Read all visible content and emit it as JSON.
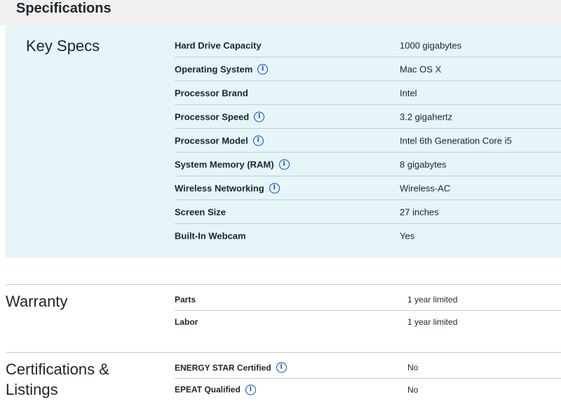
{
  "header": {
    "title": "Specifications"
  },
  "key_specs": {
    "title": "Key Specs",
    "rows": [
      {
        "label": "Hard Drive Capacity",
        "value": "1000 gigabytes",
        "info": false
      },
      {
        "label": "Operating System",
        "value": "Mac OS X",
        "info": true
      },
      {
        "label": "Processor Brand",
        "value": "Intel",
        "info": false
      },
      {
        "label": "Processor Speed",
        "value": "3.2 gigahertz",
        "info": true
      },
      {
        "label": "Processor Model",
        "value": "Intel 6th Generation Core i5",
        "info": true
      },
      {
        "label": "System Memory (RAM)",
        "value": "8 gigabytes",
        "info": true
      },
      {
        "label": "Wireless Networking",
        "value": "Wireless-AC",
        "info": true
      },
      {
        "label": "Screen Size",
        "value": "27 inches",
        "info": false
      },
      {
        "label": "Built-In Webcam",
        "value": "Yes",
        "info": false
      }
    ]
  },
  "warranty": {
    "title": "Warranty",
    "rows": [
      {
        "label": "Parts",
        "value": "1 year limited"
      },
      {
        "label": "Labor",
        "value": "1 year limited"
      }
    ]
  },
  "certifications": {
    "title_line1": "Certifications &",
    "title_line2": "Listings",
    "rows": [
      {
        "label": "ENERGY STAR Certified",
        "value": "No",
        "info": true
      },
      {
        "label": "EPEAT Qualified",
        "value": "No",
        "info": true
      }
    ]
  },
  "icons": {
    "info": "info-circle-icon"
  },
  "colors": {
    "key_specs_bg": "#e5f5f8",
    "header_bg": "#f0f0f0",
    "info_icon": "#0a4abf"
  }
}
